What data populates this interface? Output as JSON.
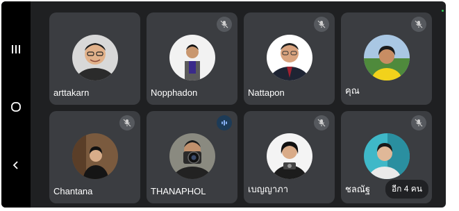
{
  "participants": [
    {
      "name": "arttakarn",
      "mic": "on"
    },
    {
      "name": "Nopphadon",
      "mic": "muted"
    },
    {
      "name": "Nattapon",
      "mic": "muted"
    },
    {
      "name": "คุณ",
      "mic": "muted"
    },
    {
      "name": "Chantana",
      "mic": "muted"
    },
    {
      "name": "THANAPHOL",
      "mic": "speaking"
    },
    {
      "name": "เบญญาภา",
      "mic": "muted"
    },
    {
      "name": "ชลณัฐ",
      "mic": "muted",
      "more_label": "อีก 4 คน"
    }
  ],
  "navigation": {
    "recents_icon": "recents-icon",
    "home_icon": "home-icon",
    "back_icon": "back-icon"
  },
  "colors": {
    "screen_bg": "#1f2022",
    "tile_bg": "#3b3d41",
    "speaking_accent": "#8ab4f8"
  }
}
